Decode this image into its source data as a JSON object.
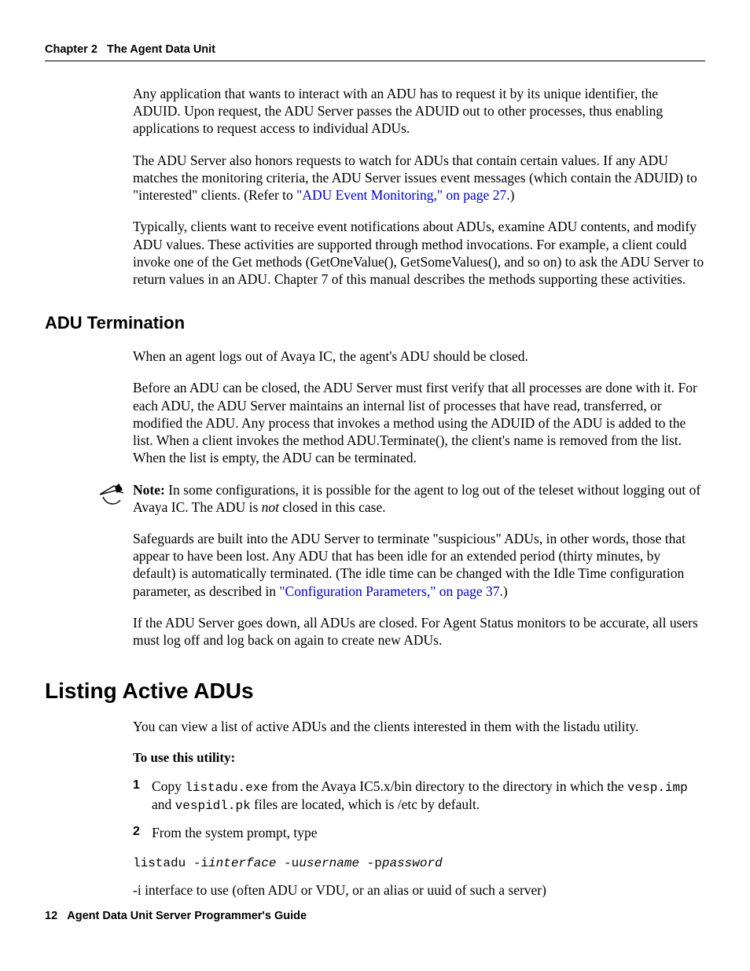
{
  "header": {
    "chapter": "Chapter 2",
    "title": "The Agent Data Unit"
  },
  "paragraphs": {
    "p1": "Any application that wants to interact with an ADU has to request it by its unique identifier, the ADUID. Upon request, the ADU Server passes the ADUID out to other processes, thus enabling applications to request access to individual ADUs.",
    "p2a": "The ADU Server also honors requests to watch for ADUs that contain certain values. If any ADU matches the monitoring criteria, the ADU Server issues event messages (which contain the ADUID) to \"interested\" clients. (Refer to ",
    "p2_link": "\"ADU Event Monitoring,\" on page 27",
    "p2b": ".)",
    "p3": "Typically, clients want to receive event notifications about ADUs, examine ADU contents, and modify ADU values. These activities are supported through method invocations. For example, a client could invoke one of the Get methods (GetOneValue(), GetSomeValues(), and so on) to ask the ADU Server to return values in an ADU. Chapter 7 of this manual describes the methods supporting these activities."
  },
  "section_termination": {
    "heading": "ADU Termination",
    "p1": "When an agent logs out of Avaya IC, the agent's ADU should be closed.",
    "p2": "Before an ADU can be closed, the ADU Server must first verify that all processes are done with it. For each ADU, the ADU Server maintains an internal list of processes that have read, transferred, or modified the ADU. Any process that invokes a method using the ADUID of the ADU is added to the list. When a client invokes the method ADU.Terminate(), the client's name is removed from the list. When the list is empty, the ADU can be terminated.",
    "note_label": "Note:",
    "note_a": "In some configurations, it is possible for the agent to log out of the teleset without logging out of Avaya IC. The ADU is ",
    "note_em": "not",
    "note_b": " closed in this case.",
    "p3a": "Safeguards are built into the ADU Server to terminate \"suspicious\" ADUs, in other words, those that appear to have been lost. Any ADU that has been idle for an extended period (thirty minutes, by default) is automatically terminated. (The idle time can be changed with the Idle Time configuration parameter, as described in ",
    "p3_link": "\"Configuration Parameters,\" on page 37",
    "p3b": ".)",
    "p4": "If the ADU Server goes down, all ADUs are closed. For Agent Status monitors to be accurate, all users must log off and log back on again to create new ADUs."
  },
  "section_listing": {
    "heading": "Listing Active ADUs",
    "p1": "You can view a list of active ADUs and the clients interested in them with the listadu utility.",
    "instr_label": "To use this utility:",
    "step1_num": "1",
    "step1_a": "Copy ",
    "step1_code1": "listadu.exe",
    "step1_b": " from the Avaya IC5.x/bin directory to the directory in which the ",
    "step1_code2": "vesp.imp",
    "step1_c": " and ",
    "step1_code3": "vespidl.pk",
    "step1_d": " files are located, which is /etc by default.",
    "step2_num": "2",
    "step2_text": "From the system prompt, type",
    "cmd_a": "listadu -i",
    "cmd_i1": "interface",
    "cmd_b": " -u",
    "cmd_i2": "username",
    "cmd_c": " -p",
    "cmd_i3": "password",
    "explain": "-i interface to use (often ADU or VDU, or an alias or uuid of such a server)"
  },
  "footer": {
    "page_num": "12",
    "guide": "Agent Data Unit Server Programmer's Guide"
  }
}
